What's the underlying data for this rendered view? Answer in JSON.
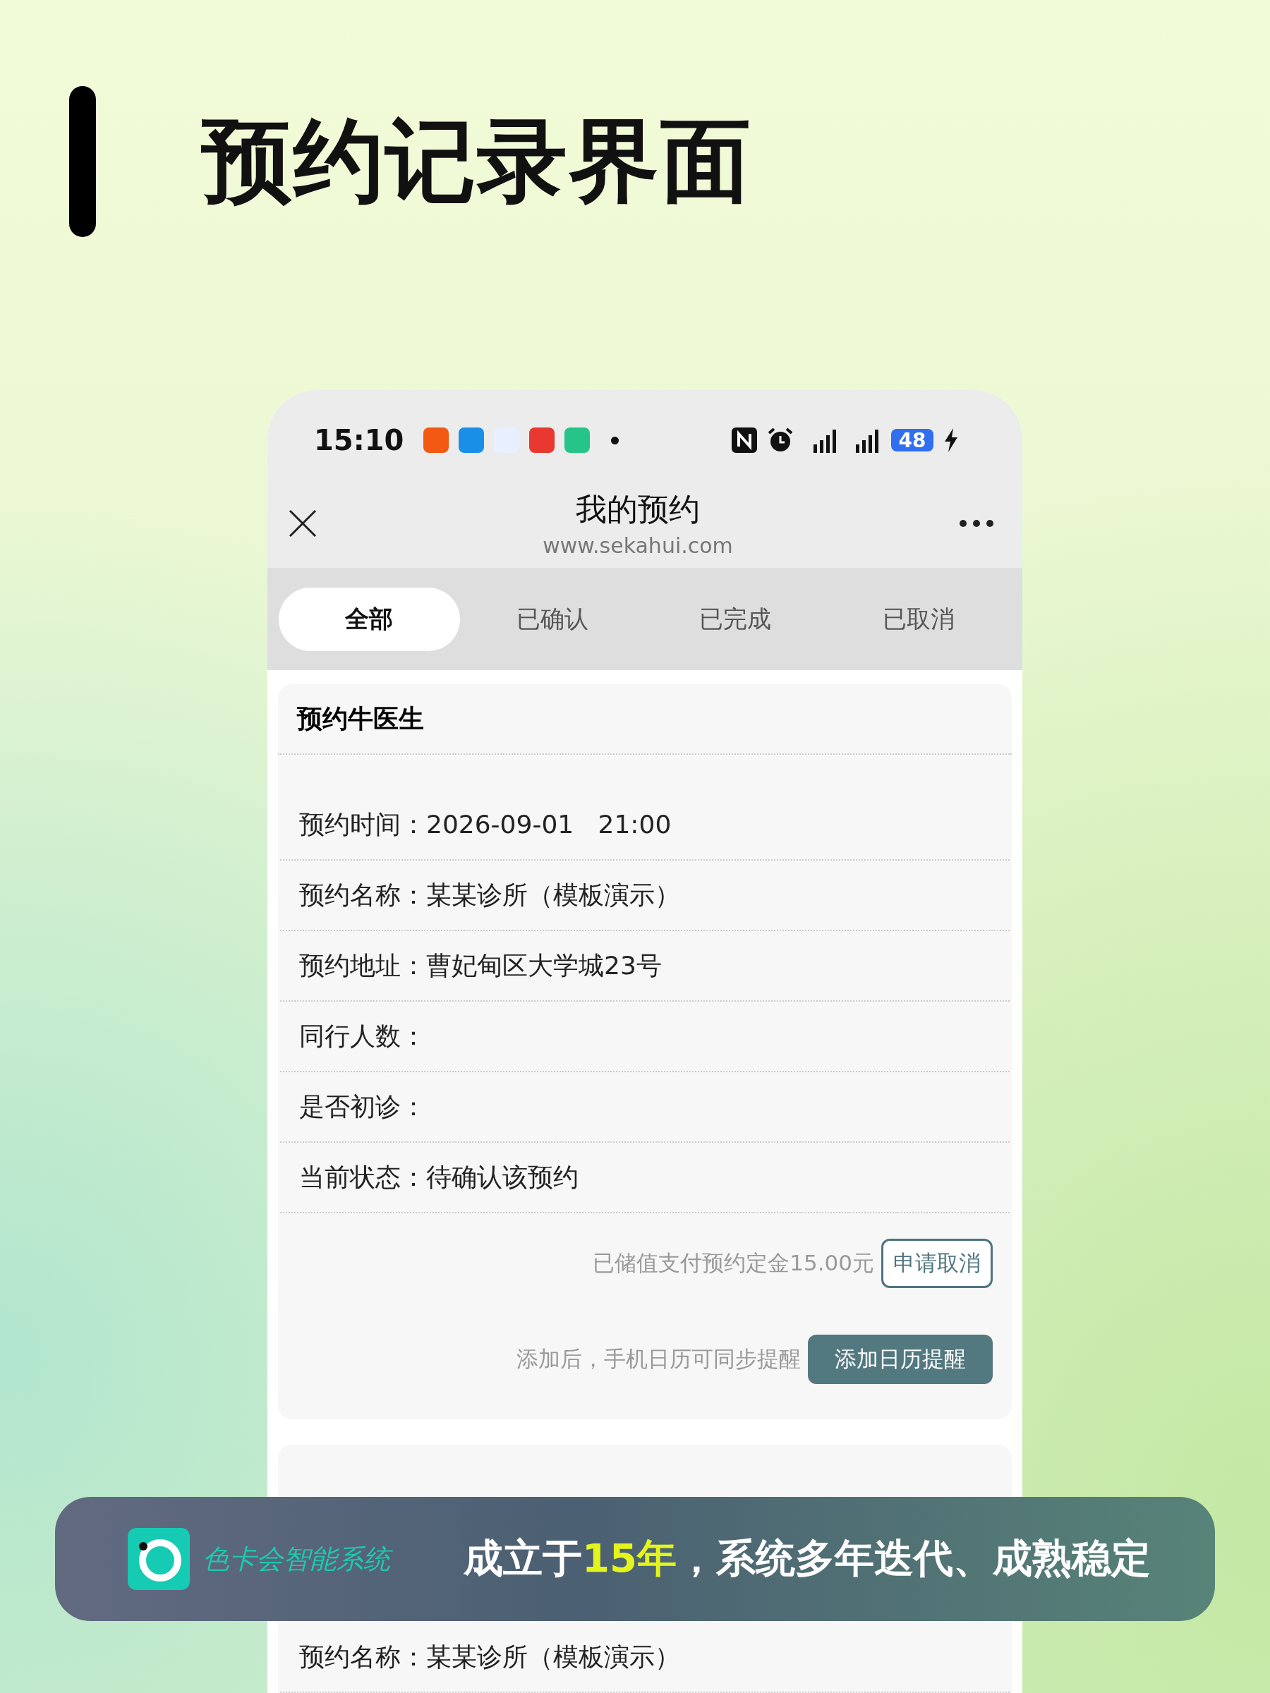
{
  "page_title": "预约记录界面",
  "status_bar": {
    "time": "15:10",
    "battery": "48"
  },
  "nav": {
    "title": "我的预约",
    "url": "www.sekahui.com"
  },
  "tabs": [
    {
      "label": "全部",
      "selected": true
    },
    {
      "label": "已确认",
      "selected": false
    },
    {
      "label": "已完成",
      "selected": false
    },
    {
      "label": "已取消",
      "selected": false
    }
  ],
  "cards": [
    {
      "title": "预约牛医生",
      "rows": [
        "预约时间：2026-09-01   21:00",
        "预约名称：某某诊所（模板演示）",
        "预约地址：曹妃甸区大学城23号",
        "同行人数：",
        "是否初诊：",
        "当前状态：待确认该预约"
      ],
      "payment_note": "已储值支付预约定金15.00元",
      "cancel_button": "申请取消",
      "calendar_note": "添加后，手机日历可同步提醒",
      "calendar_button": "添加日历提醒"
    },
    {
      "rows": [
        "预约名称：某某诊所（模板演示）"
      ]
    }
  ],
  "banner": {
    "brand": "色卡会智能系统",
    "slogan": "成立于**15年**，系统多年迭代、成熟稳定"
  }
}
